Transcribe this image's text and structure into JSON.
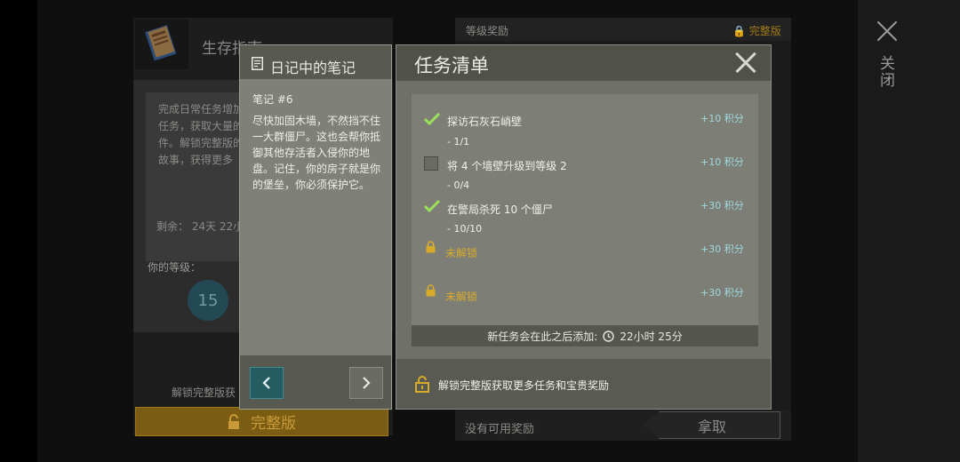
{
  "background": {
    "guide_title": "生存指南",
    "guide_desc": "完成日常任务增加任务，获取大量的件。解锁完整版的故事，获得更多",
    "remaining": "剩余： 24天 22小",
    "level_label": "你的等级：",
    "level_value": "15",
    "unlock_text": "解锁完整版获",
    "full_version_button": "完整版",
    "level_reward": "等级奖励",
    "full_version_badge": "完整版",
    "no_reward": "没有可用奖励",
    "claim_button": "拿取"
  },
  "right_strip": {
    "close_label": "关闭"
  },
  "diary": {
    "title": "日记中的笔记",
    "note_number": "笔记 #6",
    "note_body": "尽快加固木墙，不然挡不住一大群僵尸。这也会帮你抵御其他存活者入侵你的地盘。记住，你的房子就是你的堡垒，你必须保护它。"
  },
  "tasks": {
    "title": "任务清单",
    "items": [
      {
        "text": "探访石灰石峭壁",
        "progress": "- 1/1",
        "points": "+10  积分",
        "done": true
      },
      {
        "text": "将 4 个墙壁升级到等级 2",
        "progress": "- 0/4",
        "points": "+10  积分",
        "done": false
      },
      {
        "text": "在警局杀死 10 个僵尸",
        "progress": "- 10/10",
        "points": "+30  积分",
        "done": true
      },
      {
        "text": "未解锁",
        "points": "+30  积分",
        "locked": true
      },
      {
        "text": "未解锁",
        "points": "+30  积分",
        "locked": true
      }
    ],
    "new_task_label": "新任务会在此之后添加:",
    "new_task_time": "22小时 25分",
    "unlock_more": "解锁完整版获取更多任务和宝贵奖励"
  },
  "colors": {
    "accent_teal": "#245c62",
    "checkmark_green": "#9be05a",
    "locked_gold": "#d8aa2c",
    "points_blue": "#9fd8e0"
  }
}
